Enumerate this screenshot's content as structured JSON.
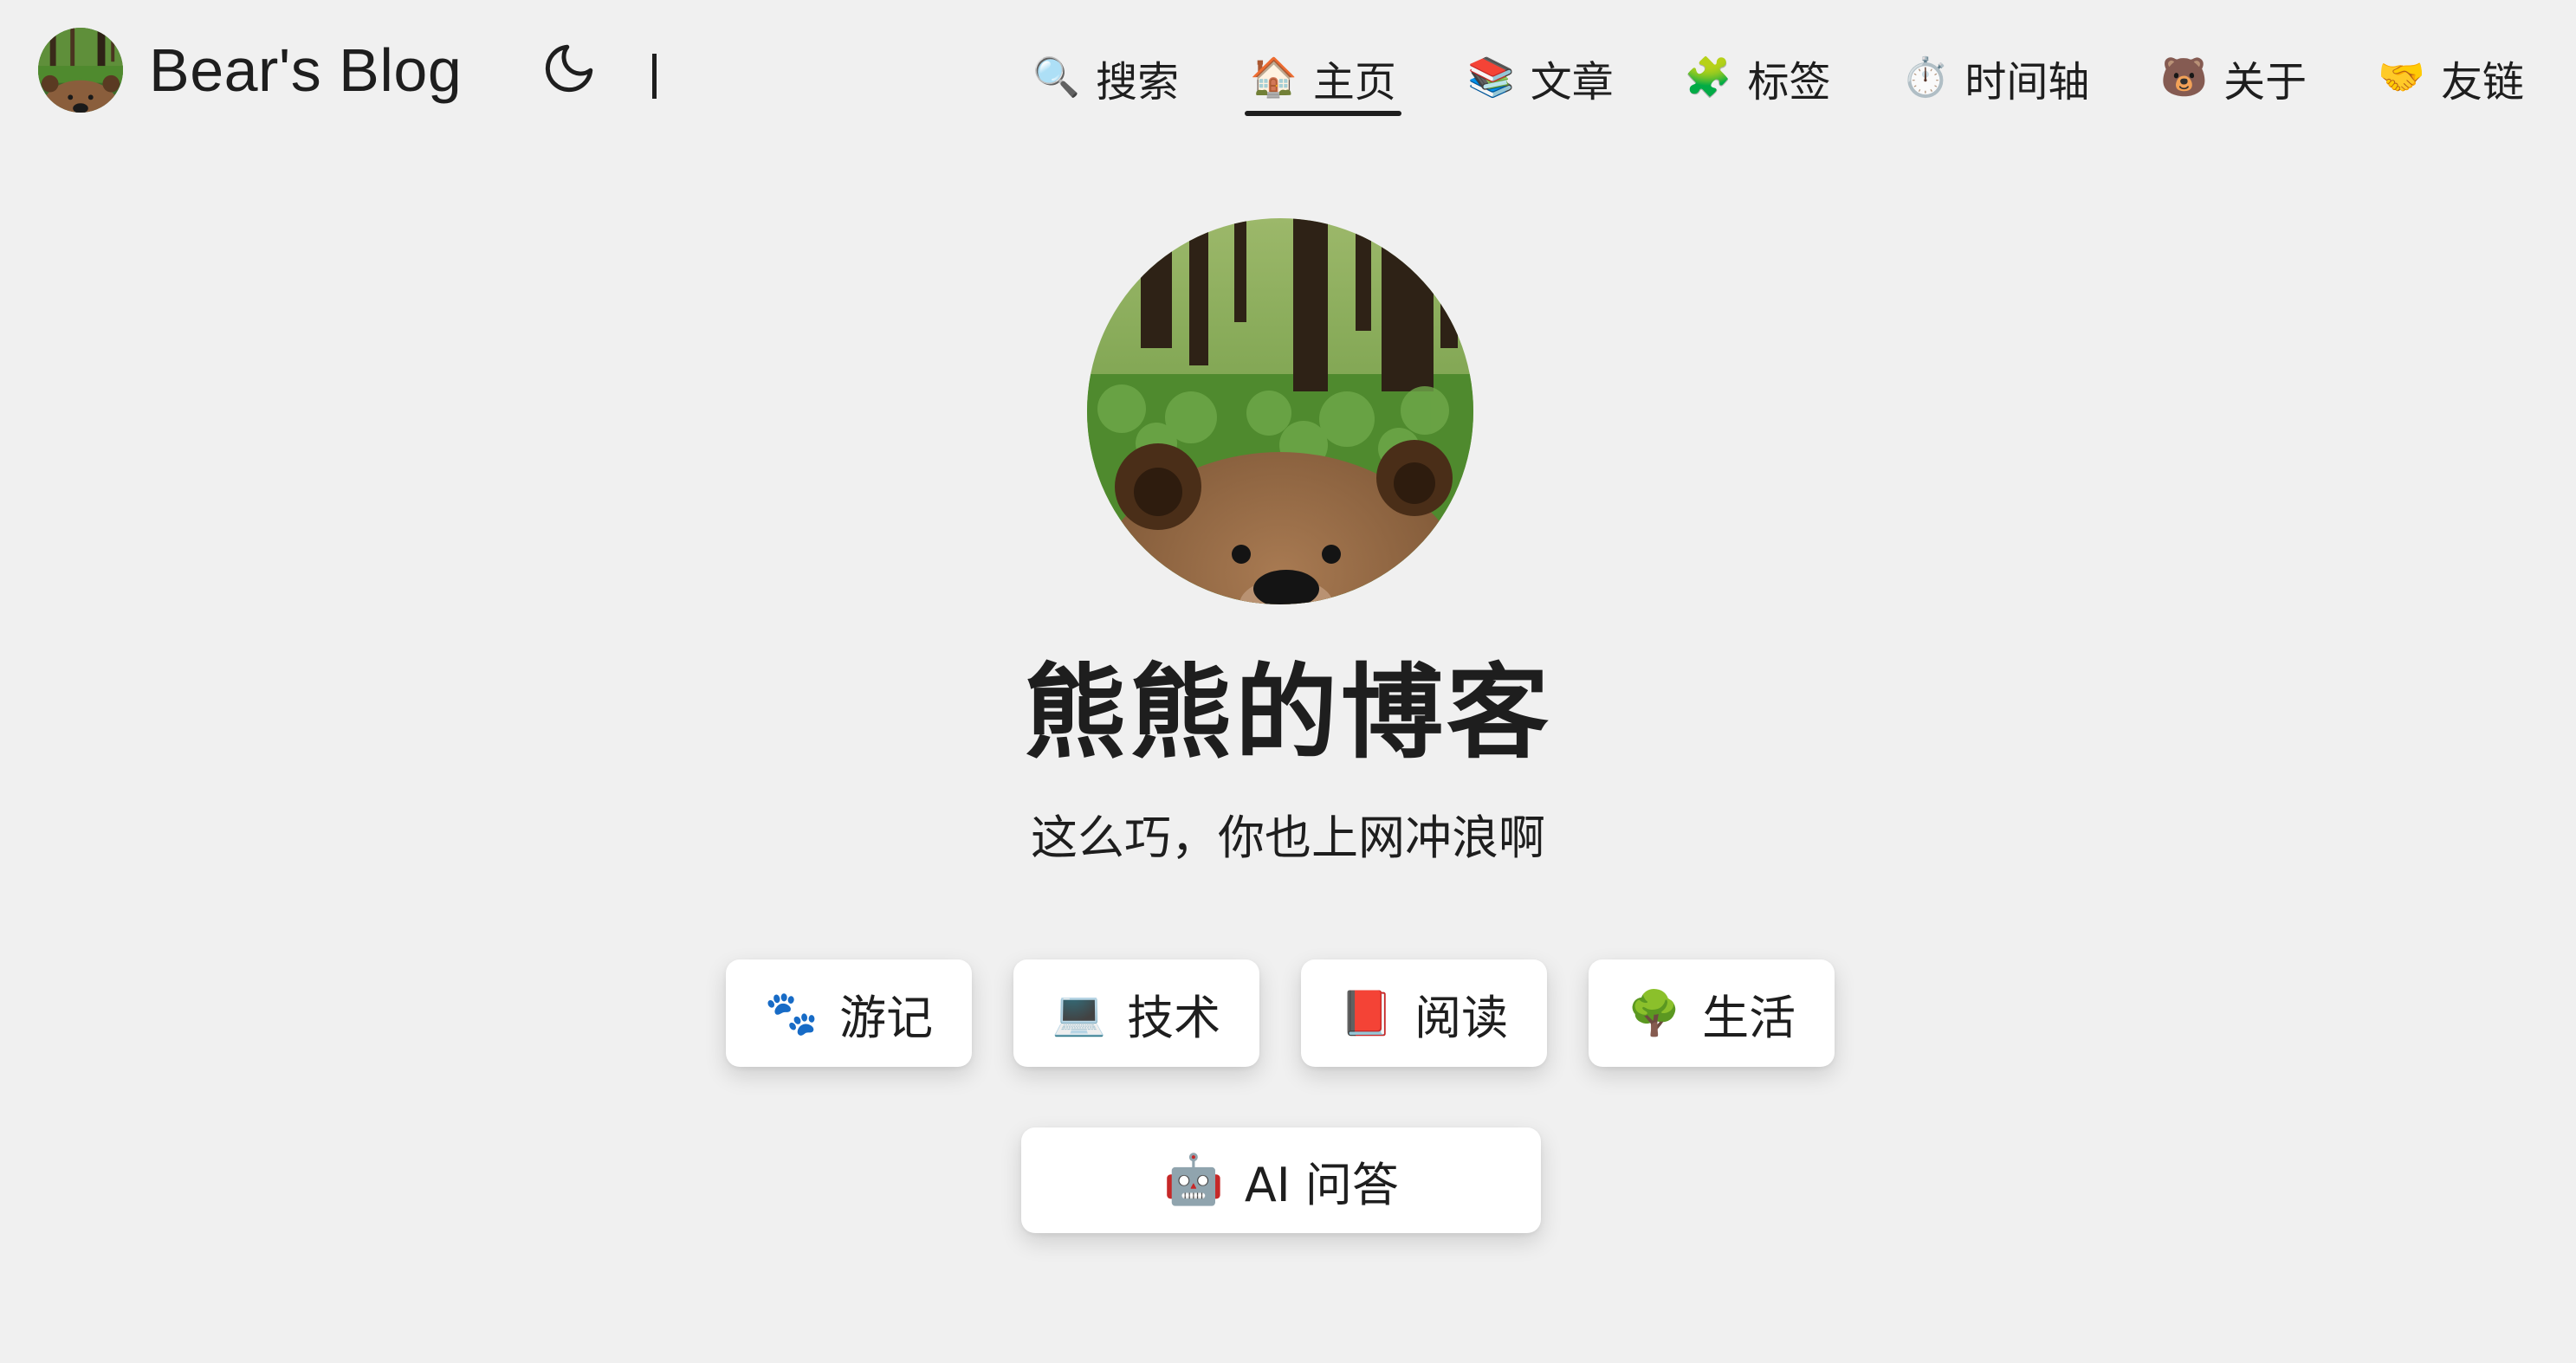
{
  "header": {
    "site_title": "Bear's Blog",
    "theme_toggle_icon": "moon-icon",
    "nav": [
      {
        "icon": "🔍",
        "icon_name": "search-icon",
        "label": "搜索",
        "active": false
      },
      {
        "icon": "🏠",
        "icon_name": "home-icon",
        "label": "主页",
        "active": true
      },
      {
        "icon": "📚",
        "icon_name": "books-icon",
        "label": "文章",
        "active": false
      },
      {
        "icon": "🧩",
        "icon_name": "puzzle-icon",
        "label": "标签",
        "active": false
      },
      {
        "icon": "⏱️",
        "icon_name": "stopwatch-icon",
        "label": "时间轴",
        "active": false
      },
      {
        "icon": "🐻",
        "icon_name": "bear-icon",
        "label": "关于",
        "active": false
      },
      {
        "icon": "🤝",
        "icon_name": "handshake-icon",
        "label": "友链",
        "active": false
      }
    ]
  },
  "hero": {
    "title": "熊熊的博客",
    "subtitle": "这么巧，你也上网冲浪啊"
  },
  "categories": [
    {
      "icon": "🐾",
      "icon_name": "paw-prints-icon",
      "label": "游记"
    },
    {
      "icon": "💻",
      "icon_name": "laptop-icon",
      "label": "技术"
    },
    {
      "icon": "📕",
      "icon_name": "book-icon",
      "label": "阅读"
    },
    {
      "icon": "🌳",
      "icon_name": "tree-icon",
      "label": "生活"
    }
  ],
  "ai_button": {
    "icon": "🤖",
    "icon_name": "robot-icon",
    "label": "AI 问答"
  },
  "colors": {
    "background": "#f0f0f0",
    "text": "#1e1e1e",
    "card": "#ffffff"
  }
}
